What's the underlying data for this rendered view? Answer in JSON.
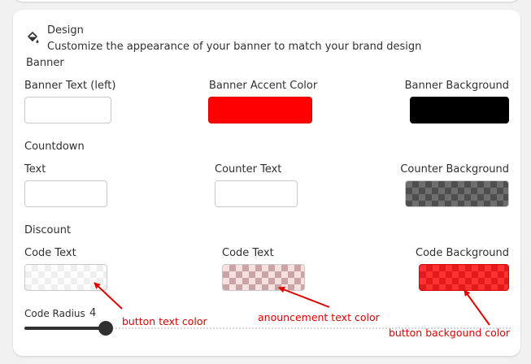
{
  "section": {
    "title": "Design",
    "subtitle": "Customize the appearance of your banner to match your brand design",
    "icon": "paint-bucket-icon"
  },
  "banner": {
    "heading": "Banner",
    "text_label": "Banner Text (left)",
    "accent_label": "Banner Accent Color",
    "background_label": "Banner Background",
    "text_color": "#ffffff",
    "accent_color": "#ff0000",
    "background_color": "#000000"
  },
  "countdown": {
    "heading": "Countdown",
    "text_label": "Text",
    "counter_text_label": "Counter Text",
    "counter_background_label": "Counter Background"
  },
  "discount": {
    "heading": "Discount",
    "code_text_label": "Code Text",
    "code_text_label_2": "Code Text",
    "code_background_label": "Code Background"
  },
  "code_radius": {
    "label": "Code Radius",
    "value": "4",
    "fraction": 0.167
  },
  "annotations": {
    "button_text": "button text color",
    "announcement_text": "anouncement text color",
    "button_background": "button backgound color",
    "color": "#e00000"
  }
}
